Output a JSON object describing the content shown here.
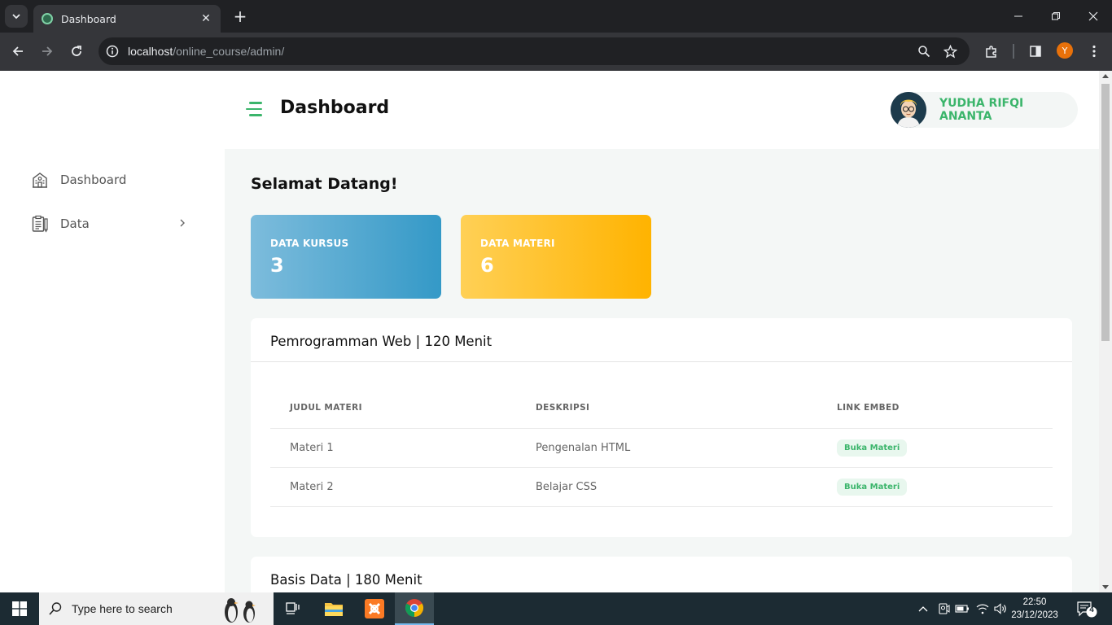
{
  "browser": {
    "tab_title": "Dashboard",
    "url_host": "localhost",
    "url_path": "/online_course/admin/",
    "profile_initial": "Y"
  },
  "sidebar": {
    "items": [
      {
        "label": "Dashboard",
        "icon": "school-building-icon"
      },
      {
        "label": "Data",
        "icon": "clipboard-list-icon"
      }
    ]
  },
  "header": {
    "title": "Dashboard",
    "user_name": "YUDHA RIFQI ANANTA"
  },
  "main": {
    "welcome": "Selamat Datang!",
    "stats": [
      {
        "label": "DATA KURSUS",
        "value": "3"
      },
      {
        "label": "DATA MATERI",
        "value": "6"
      }
    ],
    "courses": [
      {
        "title": "Pemrogramman Web | 120 Menit",
        "columns": [
          "JUDUL MATERI",
          "DESKRIPSI",
          "LINK EMBED"
        ],
        "rows": [
          {
            "judul": "Materi 1",
            "deskripsi": "Pengenalan HTML",
            "link": "Buka Materi"
          },
          {
            "judul": "Materi 2",
            "deskripsi": "Belajar CSS",
            "link": "Buka Materi"
          }
        ]
      },
      {
        "title": "Basis Data | 180 Menit"
      }
    ]
  },
  "taskbar": {
    "search_placeholder": "Type here to search",
    "time": "22:50",
    "date": "23/12/2023",
    "notification_count": "4"
  },
  "colors": {
    "accent_green": "#3bb56b",
    "kursus_card": "#3499c7",
    "materi_card": "#ffb300"
  }
}
